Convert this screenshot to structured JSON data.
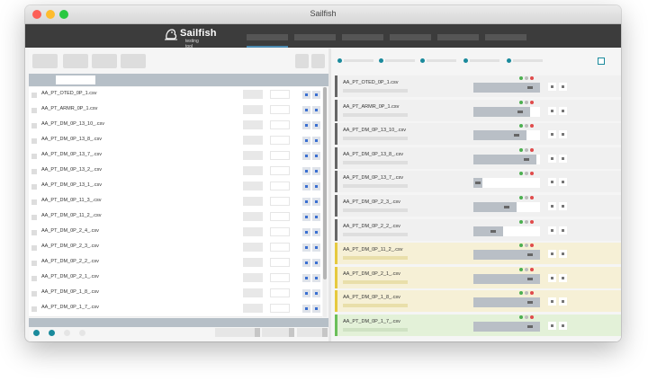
{
  "window": {
    "title": "Sailfish"
  },
  "app": {
    "logo_name": "Sailfish",
    "logo_tagline": "testing tool"
  },
  "files": [
    "AA_PT_OTED_0P_1.csv",
    "AA_PT_ARMR_0P_1.csv",
    "AA_PT_DM_0P_13_10_.csv",
    "AA_PT_DM_0P_13_8_.csv",
    "AA_PT_DM_0P_13_7_.csv",
    "AA_PT_DM_0P_13_2_.csv",
    "AA_PT_DM_0P_13_1_.csv",
    "AA_PT_DM_0P_11_3_.csv",
    "AA_PT_DM_0P_11_2_.csv",
    "AA_PT_DM_0P_2_4_.csv",
    "AA_PT_DM_0P_2_3_.csv",
    "AA_PT_DM_0P_2_2_.csv",
    "AA_PT_DM_0P_2_1_.csv",
    "AA_PT_DM_0P_1_8_.csv",
    "AA_PT_DM_0P_1_7_.csv"
  ],
  "results": [
    {
      "file": "AA_PT_OTED_0P_1.csv",
      "status": "neutral",
      "progress": 1.0,
      "progress_start": 0.0
    },
    {
      "file": "AA_PT_ARMR_0P_1.csv",
      "status": "neutral",
      "progress": 0.85,
      "progress_start": 0.0
    },
    {
      "file": "AA_PT_DM_0P_13_10_.csv",
      "status": "neutral",
      "progress": 0.8,
      "progress_start": 0.0
    },
    {
      "file": "AA_PT_DM_0P_13_8_.csv",
      "status": "neutral",
      "progress": 0.95,
      "progress_start": 0.0
    },
    {
      "file": "AA_PT_DM_0P_13_7_.csv",
      "status": "neutral",
      "progress": 0.14,
      "progress_start": 0.0
    },
    {
      "file": "AA_PT_DM_0P_2_3_.csv",
      "status": "neutral",
      "progress": 0.65,
      "progress_start": 0.0
    },
    {
      "file": "AA_PT_DM_0P_2_2_.csv",
      "status": "neutral",
      "progress": 0.45,
      "progress_start": 0.0
    },
    {
      "file": "AA_PT_DM_0P_11_2_.csv",
      "status": "warning",
      "progress": 1.0,
      "progress_start": 0.0
    },
    {
      "file": "AA_PT_DM_0P_2_1_.csv",
      "status": "warning",
      "progress": 1.0,
      "progress_start": 0.0
    },
    {
      "file": "AA_PT_DM_0P_1_8_.csv",
      "status": "warning",
      "progress": 1.0,
      "progress_start": 0.0
    },
    {
      "file": "AA_PT_DM_0P_1_7_.csv",
      "status": "success",
      "progress": 1.0,
      "progress_start": 0.0
    }
  ],
  "colors": {
    "accent": "#1a8a9c",
    "status_green": "#4caf50",
    "status_red": "#e04b4b",
    "status_gray": "#bdbdbd",
    "warning_bg": "#f6f0d6",
    "success_bg": "#e3f1d8"
  },
  "icons": {
    "logo": "fish-logo-icon",
    "row_action": "square-dot-icon"
  }
}
